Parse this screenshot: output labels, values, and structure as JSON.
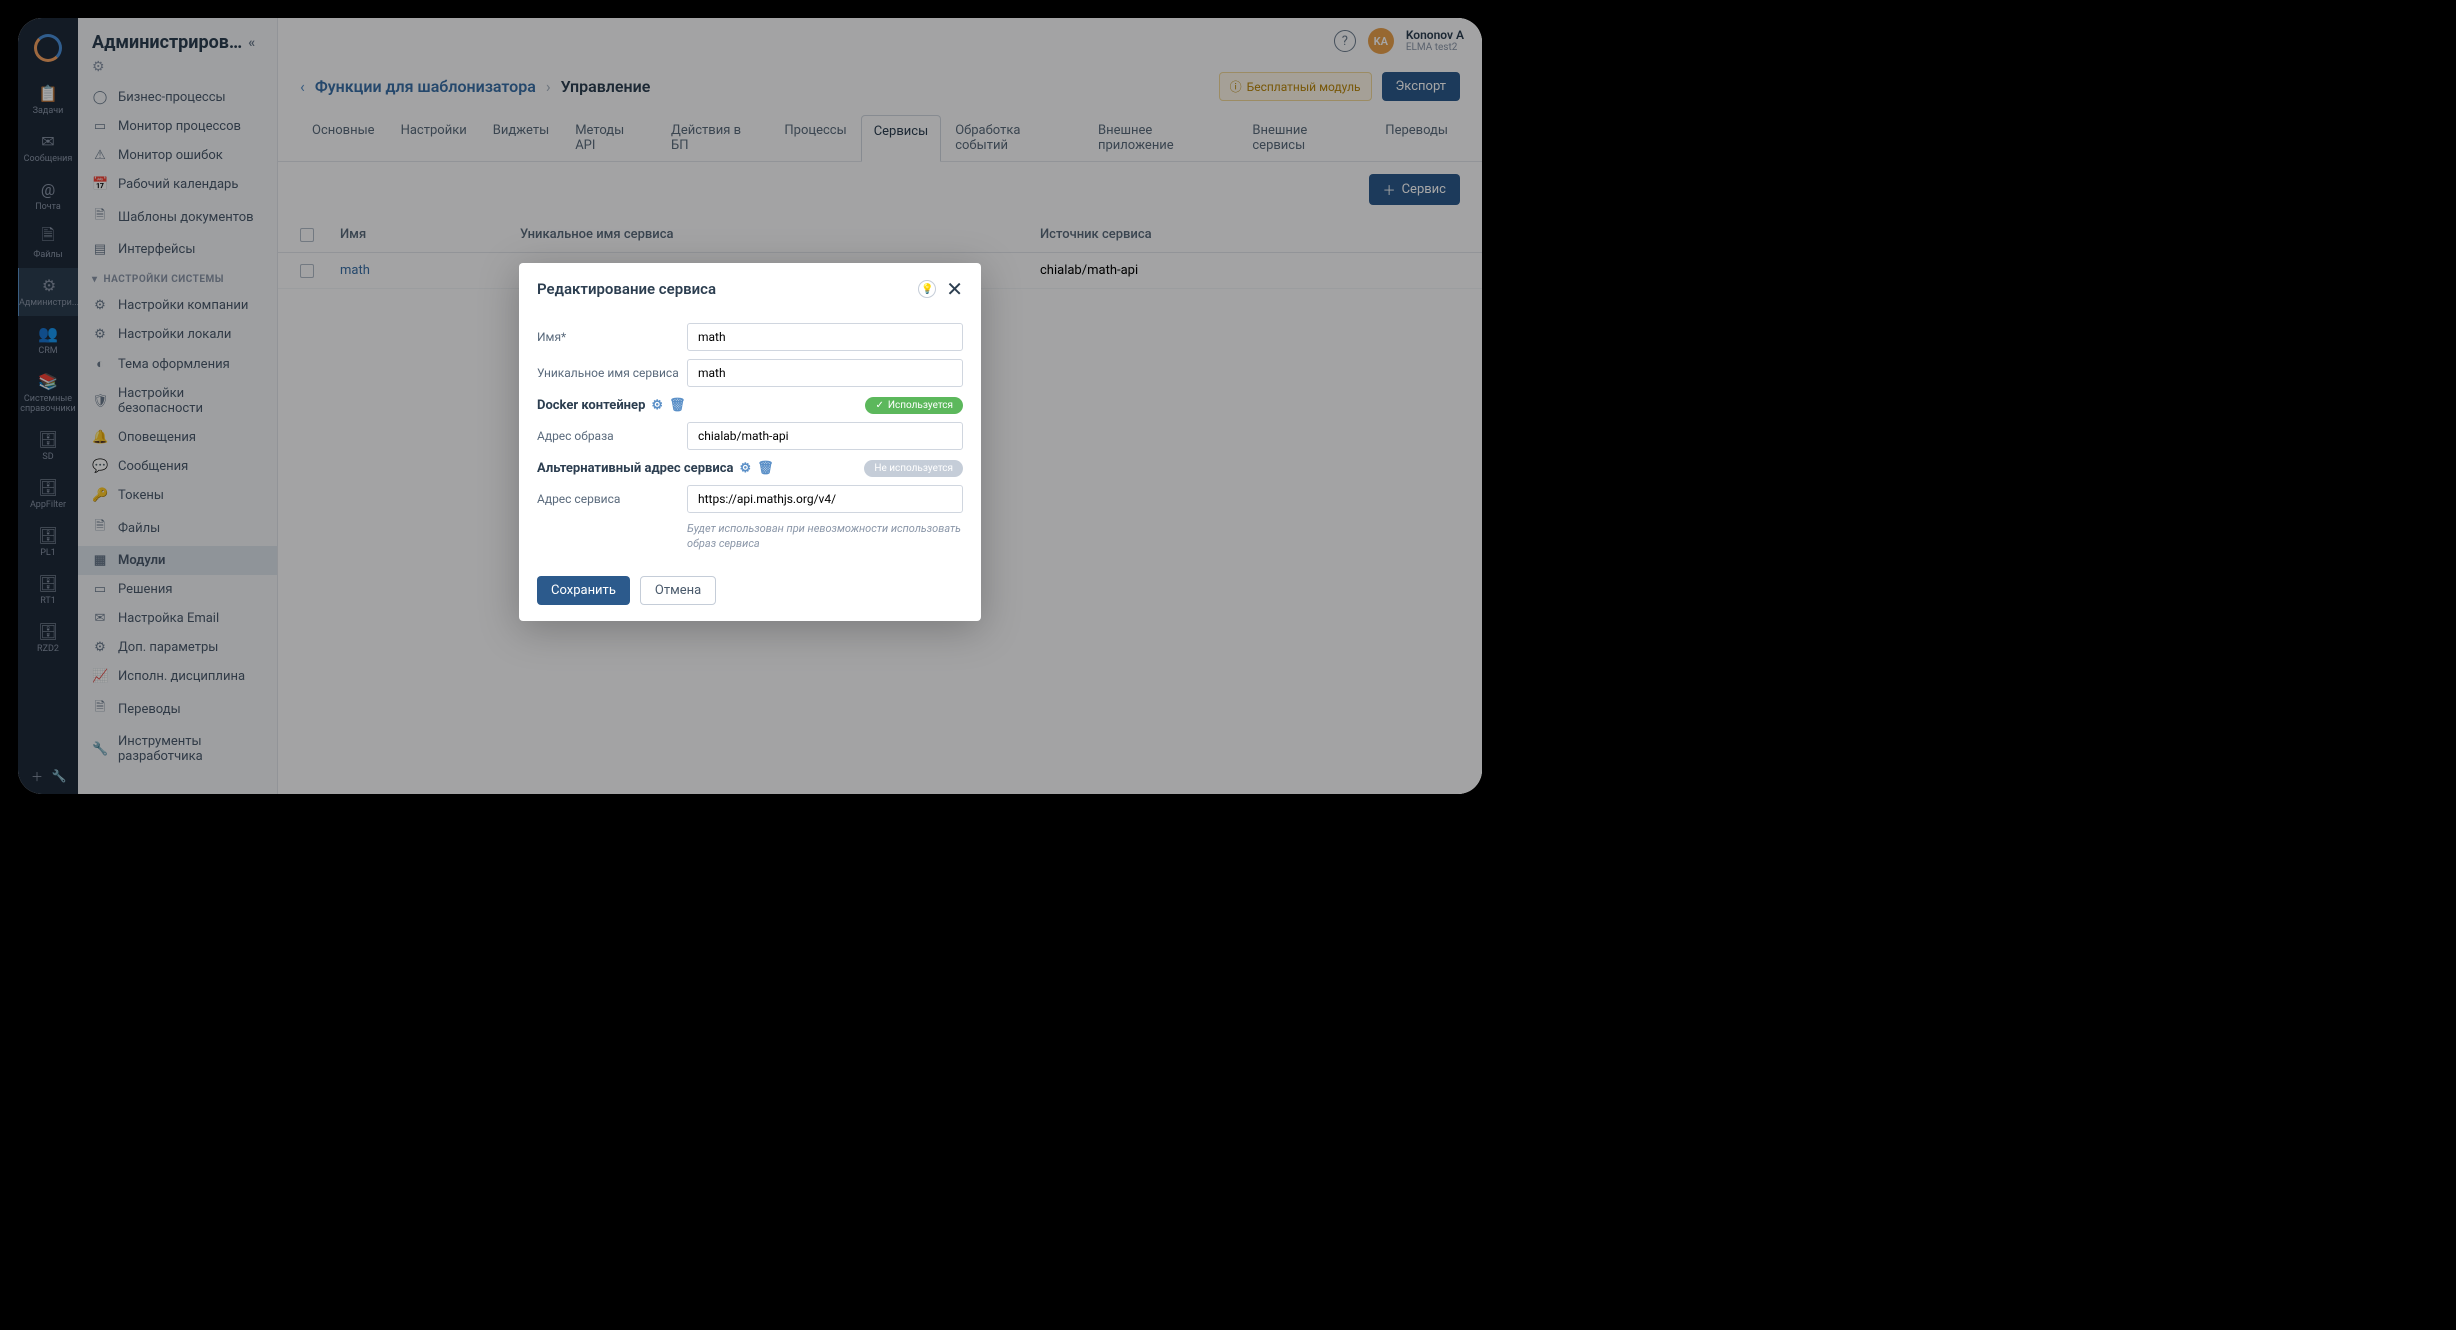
{
  "rail": [
    {
      "icon": "📋",
      "label": "Задачи"
    },
    {
      "icon": "✉",
      "label": "Сообщения"
    },
    {
      "icon": "@",
      "label": "Почта"
    },
    {
      "icon": "🗎",
      "label": "Файлы"
    },
    {
      "icon": "⚙",
      "label": "Администри...",
      "active": true
    },
    {
      "icon": "👥",
      "label": "CRM"
    },
    {
      "icon": "📚",
      "label": "Системные справочники"
    },
    {
      "icon": "🗄",
      "label": "SD"
    },
    {
      "icon": "🗄",
      "label": "AppFilter"
    },
    {
      "icon": "🗄",
      "label": "PL1"
    },
    {
      "icon": "🗄",
      "label": "RT1"
    },
    {
      "icon": "🗄",
      "label": "RZD2"
    }
  ],
  "sidebar": {
    "title": "Администриров…",
    "items1": [
      {
        "icon": "◯",
        "label": "Бизнес-процессы"
      },
      {
        "icon": "▭",
        "label": "Монитор процессов"
      },
      {
        "icon": "⚠",
        "label": "Монитор ошибок"
      },
      {
        "icon": "📅",
        "label": "Рабочий календарь"
      },
      {
        "icon": "🗎",
        "label": "Шаблоны документов"
      },
      {
        "icon": "▤",
        "label": "Интерфейсы"
      }
    ],
    "section": "НАСТРОЙКИ СИСТЕМЫ",
    "items2": [
      {
        "icon": "⚙",
        "label": "Настройки компании"
      },
      {
        "icon": "⚙",
        "label": "Настройки локали"
      },
      {
        "icon": "◐",
        "label": "Тема оформления"
      },
      {
        "icon": "🛡",
        "label": "Настройки безопасности"
      },
      {
        "icon": "🔔",
        "label": "Оповещения"
      },
      {
        "icon": "💬",
        "label": "Сообщения"
      },
      {
        "icon": "🔑",
        "label": "Токены"
      },
      {
        "icon": "🗎",
        "label": "Файлы"
      },
      {
        "icon": "▦",
        "label": "Модули",
        "active": true
      },
      {
        "icon": "▭",
        "label": "Решения"
      },
      {
        "icon": "✉",
        "label": "Настройка Email"
      },
      {
        "icon": "⚙",
        "label": "Доп. параметры"
      },
      {
        "icon": "📈",
        "label": "Исполн. дисциплина"
      },
      {
        "icon": "🗎",
        "label": "Переводы"
      },
      {
        "icon": "🔧",
        "label": "Инструменты разработчика"
      }
    ]
  },
  "user": {
    "initials": "KA",
    "name": "Kononov A",
    "tenant": "ELMA test2"
  },
  "breadcrumb": {
    "link": "Функции для шаблонизатора",
    "current": "Управление"
  },
  "badge_free": "Бесплатный модуль",
  "export_btn": "Экспорт",
  "tabs": [
    "Основные",
    "Настройки",
    "Виджеты",
    "Методы API",
    "Действия в БП",
    "Процессы",
    "Сервисы",
    "Обработка событий",
    "Внешнее приложение",
    "Внешние сервисы",
    "Переводы"
  ],
  "active_tab": "Сервисы",
  "add_btn": "Сервис",
  "table": {
    "headers": [
      "Имя",
      "Уникальное имя сервиса",
      "Источник сервиса"
    ],
    "rows": [
      {
        "name": "math",
        "unique": "",
        "source": "chialab/math-api"
      }
    ]
  },
  "modal": {
    "title": "Редактирование сервиса",
    "name_label": "Имя*",
    "name_value": "math",
    "unique_label": "Уникальное имя сервиса",
    "unique_value": "math",
    "docker_label": "Docker контейнер",
    "docker_badge": "Используется",
    "image_label": "Адрес образа",
    "image_value": "chialab/math-api",
    "alt_label": "Альтернативный адрес сервиса",
    "alt_badge": "Не используется",
    "svc_label": "Адрес сервиса",
    "svc_value": "https://api.mathjs.org/v4/",
    "help": "Будет использован при невозможности использовать образ сервиса",
    "save": "Сохранить",
    "cancel": "Отмена"
  }
}
